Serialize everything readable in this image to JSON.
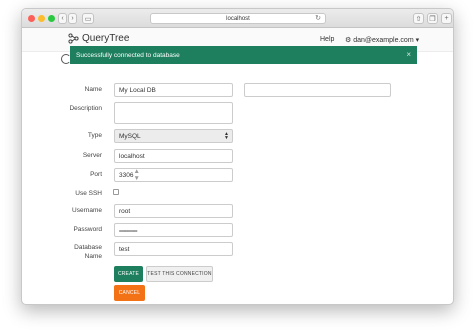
{
  "browser": {
    "url": "localhost"
  },
  "app": {
    "logo_text": "QueryTree",
    "help_label": "Help",
    "user_label": "dan@example.com"
  },
  "alert": {
    "message": "Successfully connected to database",
    "close_glyph": "×"
  },
  "form": {
    "name_label": "Name",
    "name_value": "My Local DB",
    "description_label": "Description",
    "description_value": "",
    "type_label": "Type",
    "type_value": "MySQL",
    "server_label": "Server",
    "server_value": "localhost",
    "port_label": "Port",
    "port_value": "3306",
    "use_ssh_label": "Use SSH",
    "use_ssh_checked": false,
    "username_label": "Username",
    "username_value": "root",
    "password_label": "Password",
    "password_value": "••••••••••••••••••••",
    "database_label_line1": "Database",
    "database_label_line2": "Name",
    "database_value": "test"
  },
  "buttons": {
    "create": "CREATE",
    "test": "TEST THIS CONNECTION",
    "cancel": "CANCEL"
  },
  "colors": {
    "primary": "#1e7f5f",
    "cancel": "#f47216"
  }
}
